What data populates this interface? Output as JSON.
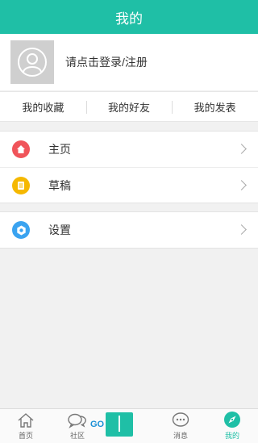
{
  "header": {
    "title": "我的"
  },
  "profile": {
    "login_text": "请点击登录/注册"
  },
  "tabs": [
    {
      "label": "我的收藏"
    },
    {
      "label": "我的好友"
    },
    {
      "label": "我的发表"
    }
  ],
  "menu_group_1": [
    {
      "label": "主页",
      "icon": "home-icon",
      "color": "#f0545a"
    },
    {
      "label": "草稿",
      "icon": "draft-icon",
      "color": "#f5b800"
    }
  ],
  "menu_group_2": [
    {
      "label": "设置",
      "icon": "settings-icon",
      "color": "#3aa3f0"
    }
  ],
  "bottom_nav": [
    {
      "label": "首页",
      "icon": "home-outline-icon"
    },
    {
      "label": "社区",
      "icon": "chat-bubbles-icon"
    },
    {
      "label": "",
      "icon": "watermark-logo"
    },
    {
      "label": "消息",
      "icon": "message-icon"
    },
    {
      "label": "我的",
      "icon": "compass-icon",
      "active": true
    }
  ],
  "watermark": {
    "text": "GO"
  },
  "colors": {
    "accent": "#1fbfa6",
    "background": "#f1f1f1"
  }
}
